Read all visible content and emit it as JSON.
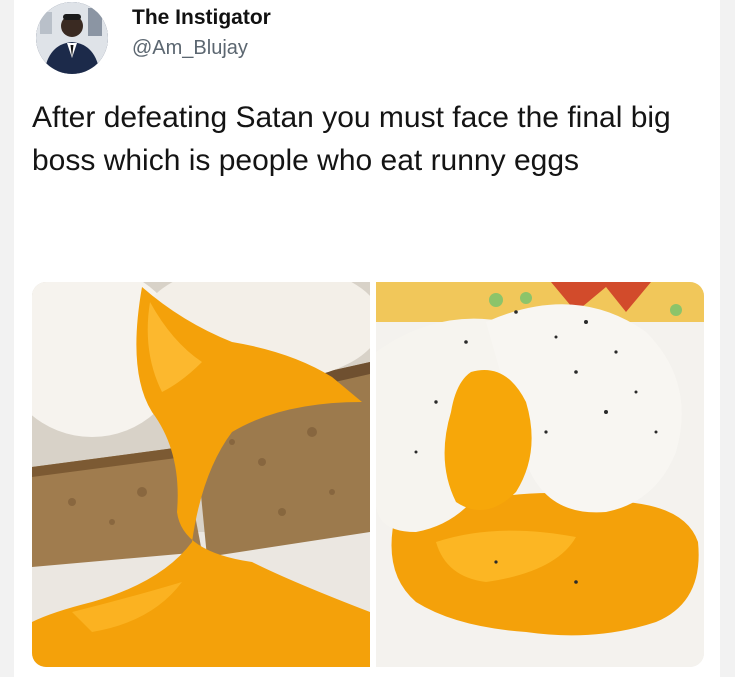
{
  "tweet": {
    "author_name": "The Instigator",
    "author_handle": "@Am_Blujay",
    "text": "After defeating Satan you must face the final big boss which is people who eat runny eggs"
  },
  "images": [
    {
      "icon": "poached-egg-on-toast-photo"
    },
    {
      "icon": "runny-poached-egg-photo"
    }
  ],
  "colors": {
    "yolk": "#f4a10a",
    "egg_white": "#f6f3ee",
    "toast": "#a07c4e",
    "text": "#141414",
    "handle": "#5b6670"
  }
}
